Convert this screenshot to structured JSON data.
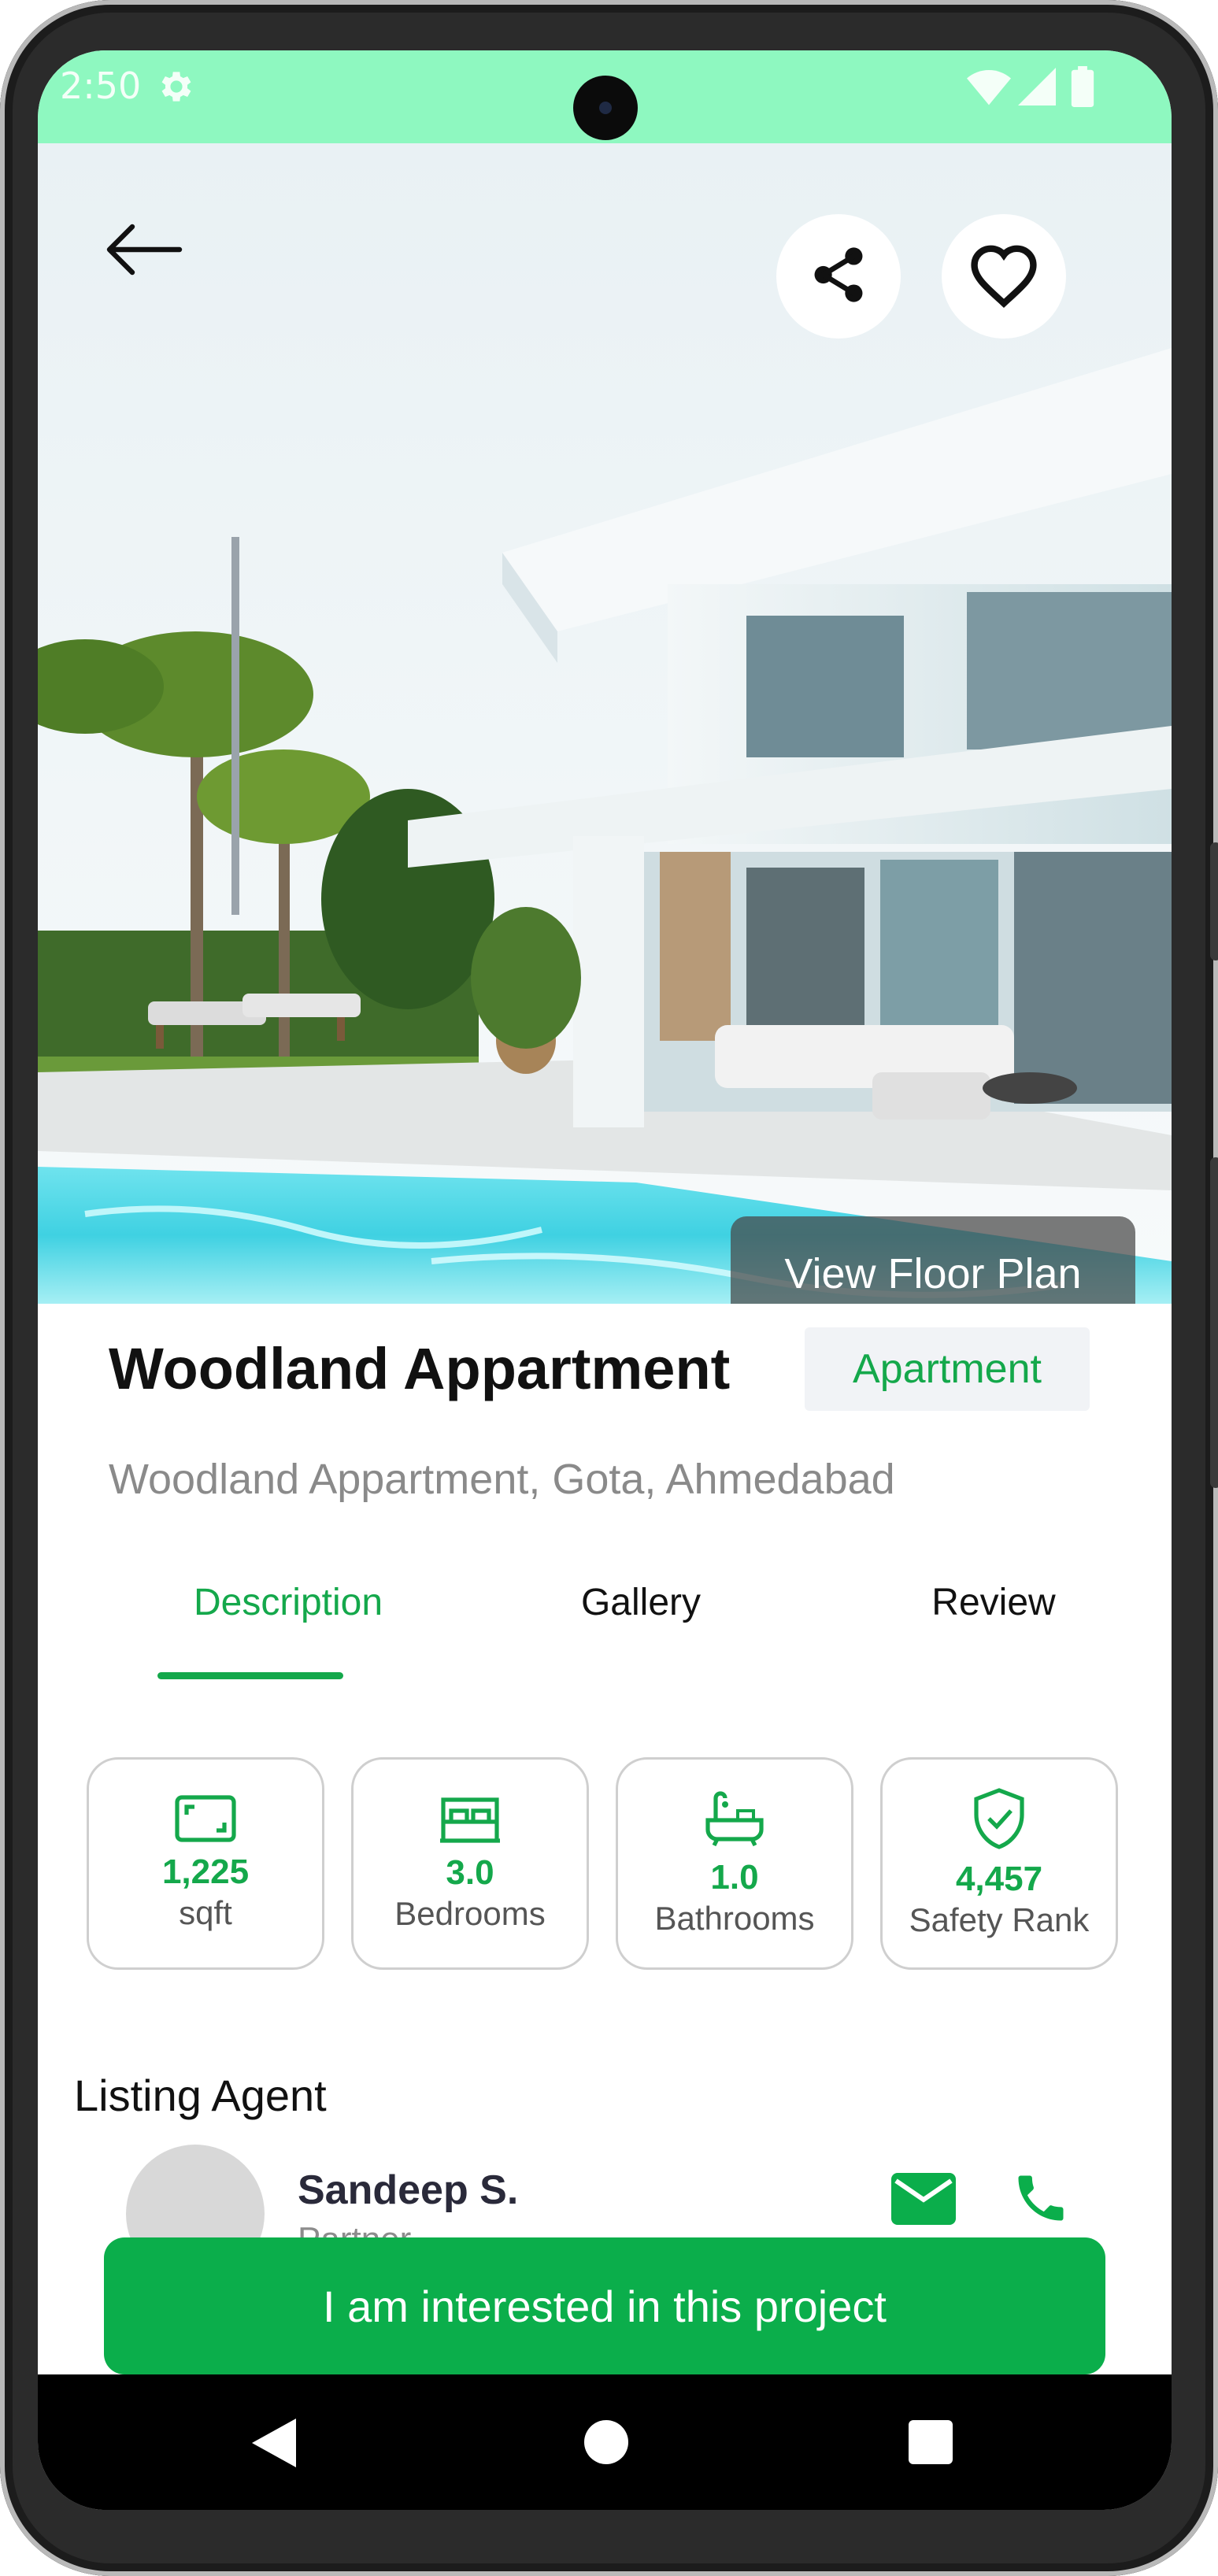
{
  "status_bar": {
    "time": "2:50",
    "icons": [
      "gear-icon",
      "wifi-icon",
      "signal-icon",
      "battery-icon"
    ]
  },
  "hero": {
    "back_icon": "arrow-left-icon",
    "share_icon": "share-icon",
    "favorite_icon": "heart-outline-icon",
    "floor_plan_label": "View Floor Plan"
  },
  "property": {
    "title": "Woodland Appartment",
    "type": "Apartment",
    "address": "Woodland Appartment, Gota, Ahmedabad"
  },
  "tabs": [
    {
      "label": "Description",
      "active": true
    },
    {
      "label": "Gallery",
      "active": false
    },
    {
      "label": "Review",
      "active": false
    }
  ],
  "features": [
    {
      "icon": "area-icon",
      "value": "1,225",
      "label": "sqft"
    },
    {
      "icon": "bed-icon",
      "value": "3.0",
      "label": "Bedrooms"
    },
    {
      "icon": "bathtub-icon",
      "value": "1.0",
      "label": "Bathrooms"
    },
    {
      "icon": "shield-check-icon",
      "value": "4,457",
      "label": "Safety Rank"
    }
  ],
  "agent": {
    "heading": "Listing Agent",
    "name": "Sandeep S.",
    "role": "Partner",
    "actions": [
      "mail-icon",
      "phone-icon"
    ]
  },
  "cta": {
    "label": "I am interested in this project"
  },
  "nav": {
    "buttons": [
      "back-triangle-icon",
      "home-circle-icon",
      "recents-square-icon"
    ]
  },
  "colors": {
    "accent": "#0bae4b",
    "status_bar": "#8ef8c0",
    "text_primary": "#111111",
    "text_muted": "#8a8a8a"
  }
}
